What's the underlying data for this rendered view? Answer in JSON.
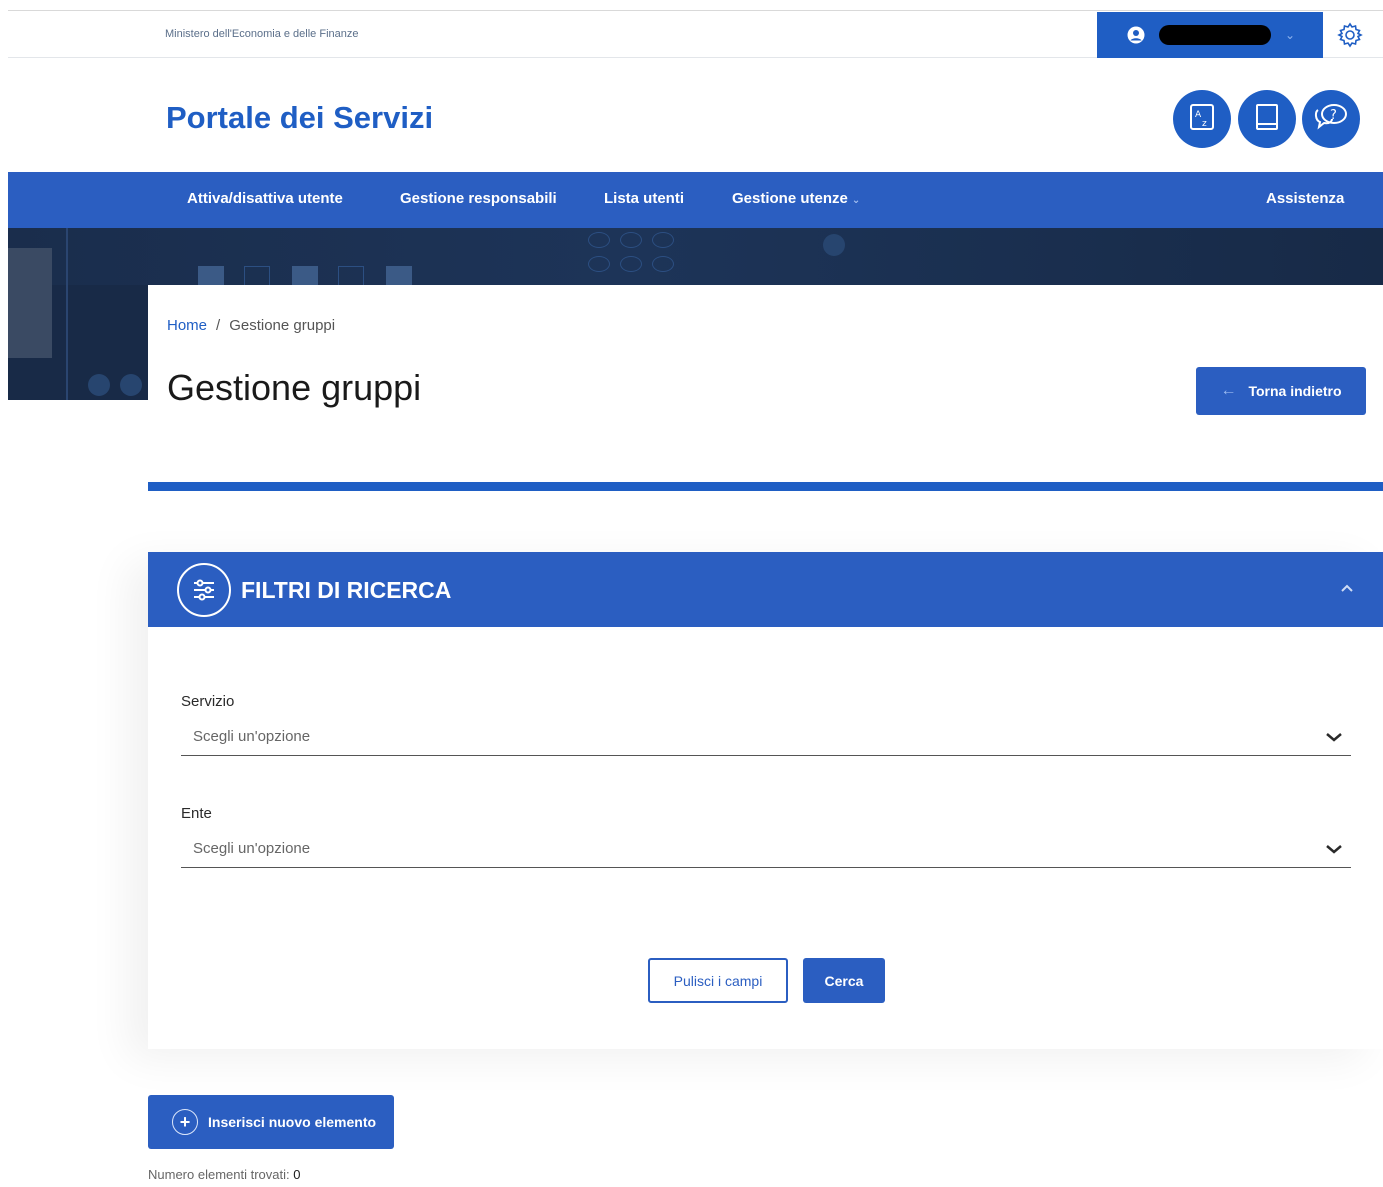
{
  "header": {
    "ministry": "Ministero dell'Economia e delle Finanze",
    "site_title": "Portale dei Servizi"
  },
  "nav": {
    "items": [
      "Attiva/disattiva utente",
      "Gestione responsabili",
      "Lista utenti",
      "Gestione utenze"
    ],
    "assistance": "Assistenza"
  },
  "breadcrumb": {
    "home": "Home",
    "separator": "/",
    "current": "Gestione gruppi"
  },
  "page": {
    "title": "Gestione gruppi",
    "back_label": "Torna indietro"
  },
  "filters": {
    "title": "FILTRI DI RICERCA",
    "servizio_label": "Servizio",
    "servizio_placeholder": "Scegli un'opzione",
    "ente_label": "Ente",
    "ente_placeholder": "Scegli un'opzione",
    "clear_label": "Pulisci i campi",
    "search_label": "Cerca"
  },
  "results": {
    "insert_label": "Inserisci nuovo elemento",
    "count_label": "Numero elementi trovati:",
    "count_value": "0"
  },
  "colors": {
    "primary": "#2b5ec1",
    "title_blue": "#1f5ec4",
    "hero_dark": "#182a47"
  },
  "icons": [
    "user-icon",
    "gear-icon",
    "glossary-icon",
    "book-icon",
    "help-chat-icon",
    "filter-sliders-icon",
    "arrow-left-icon",
    "add-circle-icon",
    "chevron-down-icon",
    "chevron-up-icon"
  ]
}
